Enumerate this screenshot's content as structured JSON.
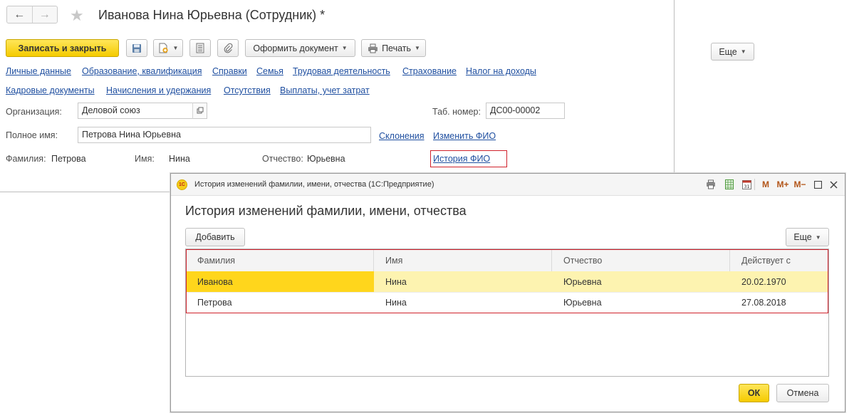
{
  "main": {
    "title": "Иванова Нина Юрьевна (Сотрудник) *",
    "toolbar": {
      "save_close_label": "Записать и закрыть",
      "oformit_label": "Оформить документ",
      "print_label": "Печать"
    },
    "eshe_label": "Еще",
    "links_row1": [
      "Личные данные",
      "Образование, квалификация",
      "Справки",
      "Семья",
      "Трудовая деятельность",
      "Страхование",
      "Налог на доходы"
    ],
    "links_row2": [
      "Кадровые документы",
      "Начисления и удержания",
      "Отсутствия",
      "Выплаты, учет затрат"
    ],
    "organization": {
      "label": "Организация:",
      "value": "Деловой союз"
    },
    "tab_number": {
      "label": "Таб. номер:",
      "value": "ДС00-00002"
    },
    "full_name": {
      "label": "Полное имя:",
      "value": "Петрова Нина Юрьевна"
    },
    "sklonenia_link": "Склонения",
    "change_fio_link": "Изменить ФИО",
    "surname": {
      "label": "Фамилия:",
      "value": "Петрова"
    },
    "name": {
      "label": "Имя:",
      "value": "Нина"
    },
    "patronymic": {
      "label": "Отчество:",
      "value": "Юрьевна"
    },
    "history_link": "История ФИО"
  },
  "dialog": {
    "window_title": "История изменений фамилии, имени, отчества  (1С:Предприятие)",
    "logo_text": "1С",
    "heading": "История изменений фамилии, имени, отчества",
    "add_label": "Добавить",
    "eshe_label": "Еще",
    "columns": [
      "Фамилия",
      "Имя",
      "Отчество",
      "Действует с"
    ],
    "rows": [
      [
        "Иванова",
        "Нина",
        "Юрьевна",
        "20.02.1970"
      ],
      [
        "Петрова",
        "Нина",
        "Юрьевна",
        "27.08.2018"
      ]
    ],
    "ok_label": "ОК",
    "cancel_label": "Отмена",
    "mm_labels": [
      "М",
      "М+",
      "М−"
    ]
  },
  "colors": {
    "accent_yellow": "#f5cb00",
    "link_blue": "#1f4fa0",
    "highlight_red": "#d0212b",
    "selected_row": "#fdf3b0",
    "current_cell": "#ffd61c"
  },
  "icons": [
    "arrow-left-icon",
    "arrow-right-icon",
    "star-icon",
    "save-icon",
    "document-add-icon",
    "list-icon",
    "paperclip-icon",
    "printer-icon",
    "open-icon",
    "1c-logo-icon",
    "print-preview-icon",
    "spreadsheet-icon",
    "calendar-icon",
    "maximize-icon",
    "close-icon"
  ]
}
